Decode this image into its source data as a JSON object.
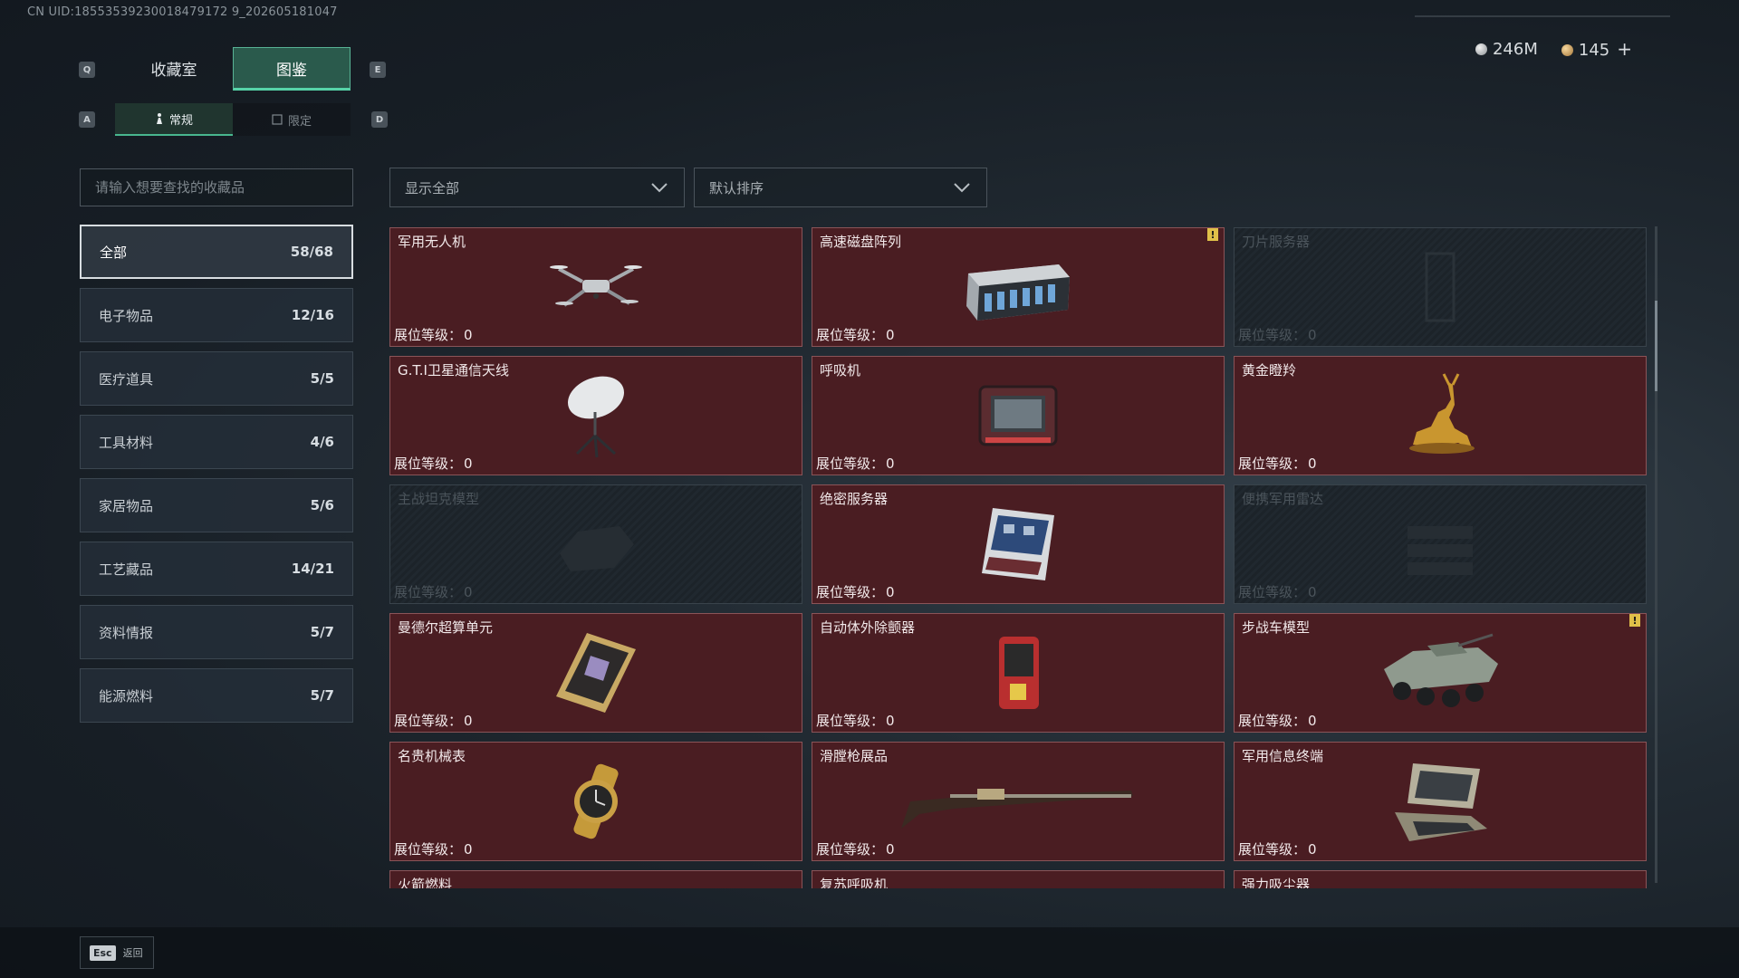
{
  "uid_text": "CN UID:18553539230018479172 9_202605181047",
  "keys": {
    "q": "Q",
    "e": "E",
    "a": "A",
    "d": "D"
  },
  "main_tabs": [
    {
      "label": "收藏室",
      "active": false
    },
    {
      "label": "图鉴",
      "active": true
    }
  ],
  "sub_tabs": [
    {
      "label": "常规",
      "active": true
    },
    {
      "label": "限定",
      "active": false
    }
  ],
  "currency": {
    "silver": "246M",
    "gold": "145",
    "plus": "+"
  },
  "search": {
    "placeholder": "请输入想要查找的收藏品"
  },
  "filter": {
    "value": "显示全部"
  },
  "sort": {
    "value": "默认排序"
  },
  "categories": [
    {
      "label": "全部",
      "count": "58/68",
      "active": true
    },
    {
      "label": "电子物品",
      "count": "12/16"
    },
    {
      "label": "医疗道具",
      "count": "5/5"
    },
    {
      "label": "工具材料",
      "count": "4/6"
    },
    {
      "label": "家居物品",
      "count": "5/6"
    },
    {
      "label": "工艺藏品",
      "count": "14/21"
    },
    {
      "label": "资料情报",
      "count": "5/7"
    },
    {
      "label": "能源燃料",
      "count": "5/7"
    }
  ],
  "level_label": "展位等级：",
  "items": [
    {
      "name": "军用无人机",
      "level": "0",
      "icon": "drone-icon"
    },
    {
      "name": "高速磁盘阵列",
      "level": "0",
      "icon": "disk-array-icon",
      "alert": "!"
    },
    {
      "name": "刀片服务器",
      "level": "0",
      "icon": "blade-server-icon",
      "locked": true
    },
    {
      "name": "G.T.I卫星通信天线",
      "level": "0",
      "icon": "satellite-dish-icon"
    },
    {
      "name": "呼吸机",
      "level": "0",
      "icon": "ventilator-icon"
    },
    {
      "name": "黄金瞪羚",
      "level": "0",
      "icon": "gold-gazelle-icon"
    },
    {
      "name": "主战坦克模型",
      "level": "0",
      "icon": "tank-model-icon",
      "locked": true
    },
    {
      "name": "绝密服务器",
      "level": "0",
      "icon": "secret-server-icon"
    },
    {
      "name": "便携军用雷达",
      "level": "0",
      "icon": "radar-icon",
      "locked": true
    },
    {
      "name": "曼德尔超算单元",
      "level": "0",
      "icon": "supercomputer-icon"
    },
    {
      "name": "自动体外除颤器",
      "level": "0",
      "icon": "defibrillator-icon"
    },
    {
      "name": "步战车模型",
      "level": "0",
      "icon": "ifv-model-icon",
      "alert": "!"
    },
    {
      "name": "名贵机械表",
      "level": "0",
      "icon": "watch-icon"
    },
    {
      "name": "滑膛枪展品",
      "level": "0",
      "icon": "musket-icon"
    },
    {
      "name": "军用信息终端",
      "level": "0",
      "icon": "terminal-icon"
    },
    {
      "name": "火箭燃料",
      "level": "",
      "icon": "rocket-fuel-icon"
    },
    {
      "name": "复苏呼吸机",
      "level": "",
      "icon": "resuscitator-icon"
    },
    {
      "name": "强力吸尘器",
      "level": "",
      "icon": "vacuum-icon"
    }
  ],
  "esc": {
    "key": "Esc",
    "label": "返回"
  },
  "colors": {
    "accent": "#56d3a8",
    "card_bg": "#4a1d22",
    "alert": "#e0c049"
  }
}
